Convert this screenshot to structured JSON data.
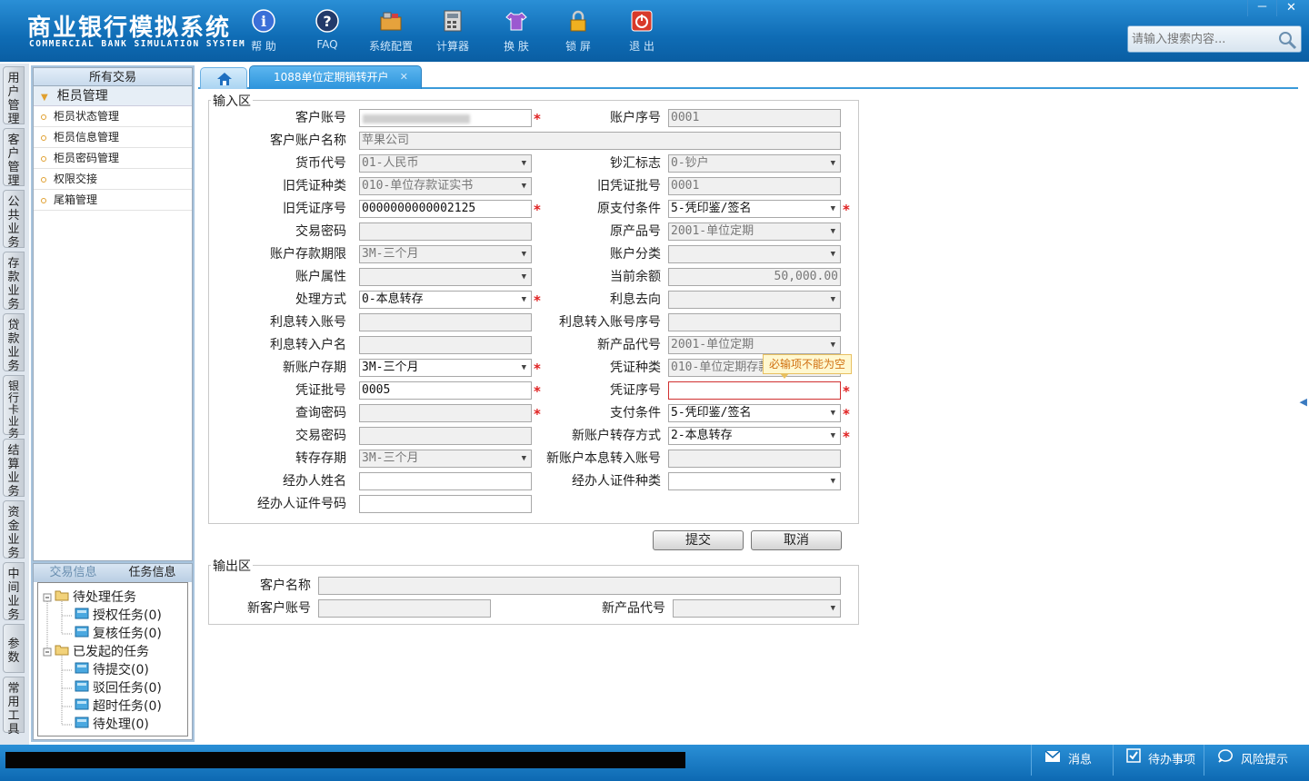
{
  "header": {
    "title_cn": "商业银行模拟系统",
    "title_en": "COMMERCIAL BANK SIMULATION SYSTEM",
    "tools": [
      {
        "label": "帮 助",
        "icon": "info-icon"
      },
      {
        "label": "FAQ",
        "icon": "help-question-icon"
      },
      {
        "label": "系统配置",
        "icon": "toolbox-icon"
      },
      {
        "label": "计算器",
        "icon": "calculator-icon"
      },
      {
        "label": "换 肤",
        "icon": "shirt-icon"
      },
      {
        "label": "锁 屏",
        "icon": "lock-icon"
      },
      {
        "label": "退 出",
        "icon": "power-icon"
      }
    ],
    "search_placeholder": "请输入搜索内容...",
    "window_buttons": [
      "－",
      "✕"
    ]
  },
  "vertical_nav": [
    "用户管理",
    "客户管理",
    "公共业务",
    "存款业务",
    "贷款业务",
    "银行卡业务",
    "结算业务",
    "资金业务",
    "中间业务",
    "参数",
    "常用工具"
  ],
  "sidebar": {
    "title": "所有交易",
    "group": "柜员管理",
    "items": [
      "柜员状态管理",
      "柜员信息管理",
      "柜员密码管理",
      "权限交接",
      "尾箱管理"
    ]
  },
  "bottom_panel": {
    "tabs": [
      "交易信息",
      "任务信息"
    ],
    "tree": [
      {
        "label": "待处理任务",
        "level": 0
      },
      {
        "label": "授权任务(0)",
        "level": 1
      },
      {
        "label": "复核任务(0)",
        "level": 1
      },
      {
        "label": "已发起的任务",
        "level": 0
      },
      {
        "label": "待提交(0)",
        "level": 1
      },
      {
        "label": "驳回任务(0)",
        "level": 1
      },
      {
        "label": "超时任务(0)",
        "level": 1
      },
      {
        "label": "待处理(0)",
        "level": 1
      }
    ]
  },
  "tabs": {
    "active": "1088单位定期销转开户",
    "close": "✕"
  },
  "input_area": {
    "title": "输入区",
    "fields": {
      "customer_account": {
        "label": "客户账号",
        "value": "",
        "required": true
      },
      "account_seq": {
        "label": "账户序号",
        "value": "0001"
      },
      "customer_name": {
        "label": "客户账户名称",
        "value": "苹果公司"
      },
      "currency": {
        "label": "货币代号",
        "value": "01-人民币"
      },
      "cash_flag": {
        "label": "钞汇标志",
        "value": "0-钞户"
      },
      "old_voucher_type": {
        "label": "旧凭证种类",
        "value": "010-单位存款证实书"
      },
      "old_voucher_batch": {
        "label": "旧凭证批号",
        "value": "0001"
      },
      "old_voucher_no": {
        "label": "旧凭证序号",
        "value": "0000000000002125",
        "required": true
      },
      "orig_pay_cond": {
        "label": "原支付条件",
        "value": "5-凭印鉴/签名",
        "required": true
      },
      "tx_password": {
        "label": "交易密码",
        "value": ""
      },
      "orig_product": {
        "label": "原产品号",
        "value": "2001-单位定期"
      },
      "deposit_term": {
        "label": "账户存款期限",
        "value": "3M-三个月"
      },
      "account_class": {
        "label": "账户分类",
        "value": ""
      },
      "account_attr": {
        "label": "账户属性",
        "value": ""
      },
      "current_balance": {
        "label": "当前余额",
        "value": "50,000.00"
      },
      "process_mode": {
        "label": "处理方式",
        "value": "0-本息转存",
        "required": true
      },
      "interest_dest": {
        "label": "利息去向",
        "value": ""
      },
      "interest_acct": {
        "label": "利息转入账号",
        "value": ""
      },
      "interest_acct_seq": {
        "label": "利息转入账号序号",
        "value": ""
      },
      "interest_acct_name": {
        "label": "利息转入户名",
        "value": ""
      },
      "new_product": {
        "label": "新产品代号",
        "value": "2001-单位定期"
      },
      "new_term": {
        "label": "新账户存期",
        "value": "3M-三个月",
        "required": true
      },
      "voucher_type": {
        "label": "凭证种类",
        "value": "010-单位定期存款"
      },
      "voucher_batch": {
        "label": "凭证批号",
        "value": "0005",
        "required": true
      },
      "voucher_no": {
        "label": "凭证序号",
        "value": "",
        "required": true
      },
      "query_password": {
        "label": "查询密码",
        "value": "",
        "required": true
      },
      "pay_cond": {
        "label": "支付条件",
        "value": "5-凭印鉴/签名",
        "required": true
      },
      "tx_password2": {
        "label": "交易密码",
        "value": ""
      },
      "new_transfer_mode": {
        "label": "新账户转存方式",
        "value": "2-本息转存",
        "required": true
      },
      "transfer_term": {
        "label": "转存存期",
        "value": "3M-三个月"
      },
      "new_interest_acct": {
        "label": "新账户本息转入账号",
        "value": ""
      },
      "agent_name": {
        "label": "经办人姓名",
        "value": ""
      },
      "agent_id_type": {
        "label": "经办人证件种类",
        "value": ""
      },
      "agent_id_no": {
        "label": "经办人证件号码",
        "value": ""
      }
    },
    "error_tip": "必输项不能为空",
    "submit": "提交",
    "cancel": "取消"
  },
  "output_area": {
    "title": "输出区",
    "customer_name": {
      "label": "客户名称",
      "value": ""
    },
    "new_account": {
      "label": "新客户账号",
      "value": ""
    },
    "new_product": {
      "label": "新产品代号",
      "value": ""
    }
  },
  "statusbar": {
    "message": "消息",
    "todo": "待办事项",
    "risk": "风险提示"
  }
}
